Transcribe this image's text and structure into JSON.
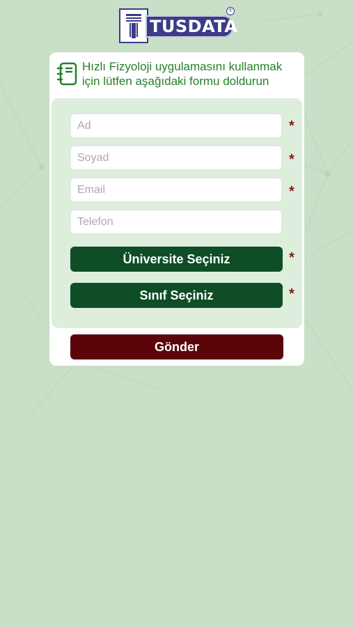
{
  "brand": {
    "logo_text": "TUSDATA",
    "reg_mark": "®"
  },
  "header": {
    "text": "Hızlı Fizyoloji uygulamasını kullanmak için lütfen aşağıdaki formu doldurun"
  },
  "form": {
    "first_name_placeholder": "Ad",
    "last_name_placeholder": "Soyad",
    "email_placeholder": "Email",
    "phone_placeholder": "Telefon",
    "required_mark": "*",
    "university_button": "Üniversite Seçiniz",
    "class_button": "Sınıf Seçiniz",
    "submit_button": "Gönder"
  },
  "colors": {
    "background": "#c9dfc7",
    "header_text": "#25802a",
    "select_button": "#0f4d26",
    "submit_button": "#5c0508",
    "required": "#8b1a1a"
  }
}
